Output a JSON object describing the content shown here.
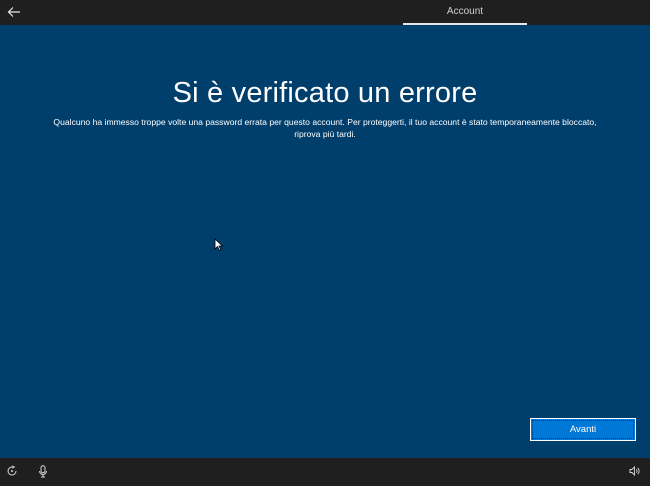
{
  "header": {
    "back_icon": "back-arrow-icon",
    "tab_label": "Account"
  },
  "main": {
    "title": "Si è verificato un errore",
    "message": "Qualcuno ha immesso troppe volte una password errata per questo account. Per proteggerti, il tuo account è stato temporaneamente bloccato, riprova più tardi."
  },
  "footer": {
    "next_label": "Avanti",
    "icons": [
      "ease-of-access-icon",
      "microphone-icon",
      "volume-icon"
    ]
  },
  "colors": {
    "background": "#003e6b",
    "bar": "#1f1f1f",
    "accent": "#0078d7"
  }
}
